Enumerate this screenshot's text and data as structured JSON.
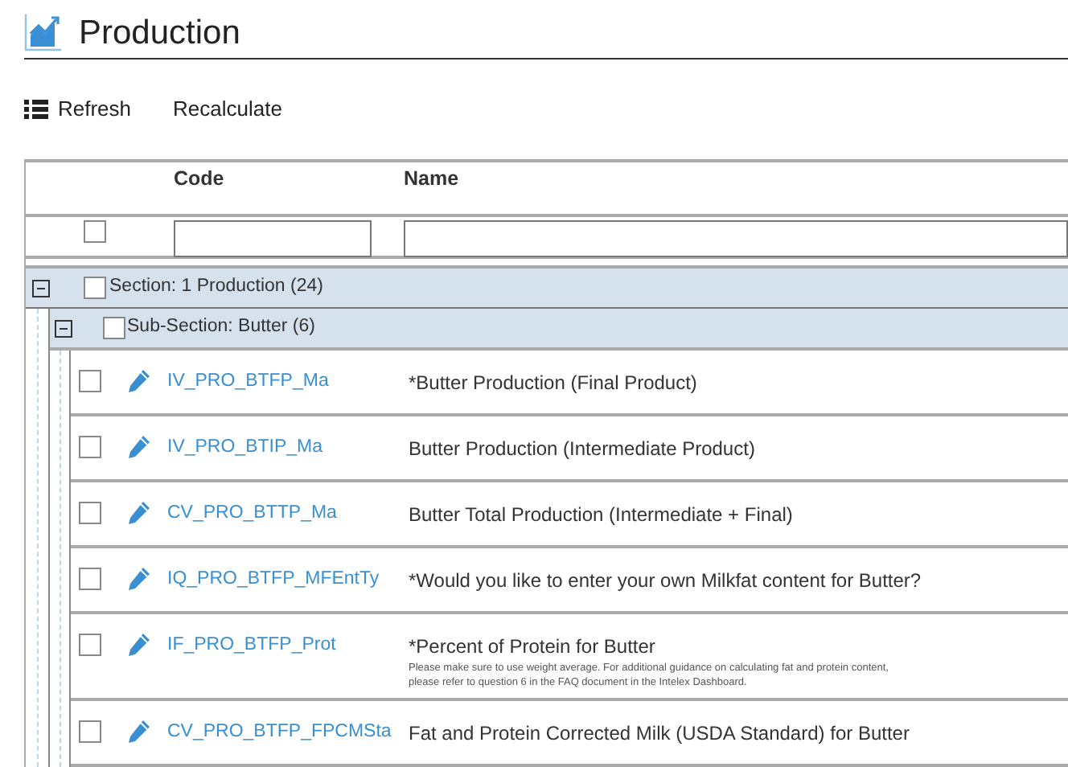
{
  "page": {
    "title": "Production"
  },
  "toolbar": [
    {
      "label": "Refresh",
      "icon": true
    },
    {
      "label": "Recalculate",
      "icon": false
    }
  ],
  "table": {
    "columns": [
      {
        "label": "Code",
        "filter": true
      },
      {
        "label": "Name",
        "filter": true
      }
    ],
    "select_all": {
      "checked": false
    },
    "sections": [
      {
        "label": "Section: 1 Production (24)",
        "expanded": true,
        "checked": false,
        "children": [
          {
            "label": "Sub-Section: Butter (6)",
            "expanded": true,
            "checked": false,
            "rows": [
              {
                "code": "IV_PRO_BTFP_Ma",
                "name": "*Butter Production (Final Product)",
                "checked": false
              },
              {
                "code": "IV_PRO_BTIP_Ma",
                "name": "Butter Production (Intermediate Product)",
                "checked": false
              },
              {
                "code": "CV_PRO_BTTP_Ma",
                "name": "Butter Total Production (Intermediate + Final)",
                "checked": false
              },
              {
                "code": "IQ_PRO_BTFP_MFEntTy",
                "name": "*Would you like to enter your own Milkfat content for Butter?",
                "checked": false
              },
              {
                "code": "IF_PRO_BTFP_Prot",
                "name": "*Percent of Protein for Butter",
                "note": [
                  "Please make sure to use weight average. For additional guidance on calculating fat and protein content,",
                  "please refer to question 6 in the FAQ document in the Intelex Dashboard."
                ],
                "checked": false
              },
              {
                "code": "CV_PRO_BTFP_FPCMSta",
                "name": "Fat and Protein Corrected Milk (USDA Standard) for Butter",
                "checked": false
              }
            ]
          }
        ]
      }
    ]
  }
}
